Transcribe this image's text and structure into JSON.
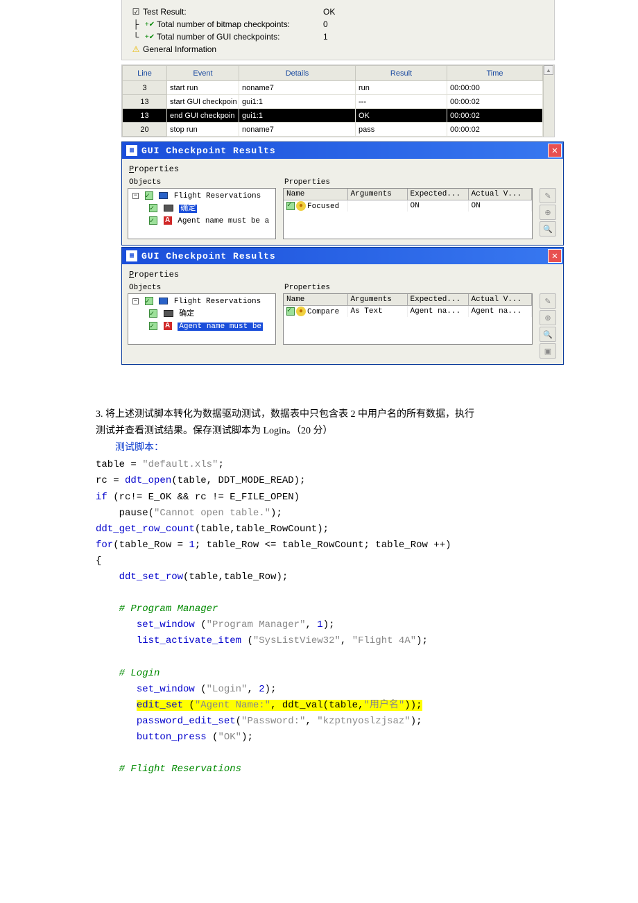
{
  "summary": {
    "rows": [
      {
        "icon": "☑",
        "label": "Test Result:",
        "value": "OK"
      },
      {
        "icon": "+✔",
        "label": "Total number of bitmap checkpoints:",
        "value": "0"
      },
      {
        "icon": "+✔",
        "label": "Total number of GUI checkpoints:",
        "value": "1"
      },
      {
        "icon": "⚠",
        "label": "General Information",
        "value": ""
      }
    ]
  },
  "log": {
    "headers": [
      "Line",
      "Event",
      "Details",
      "Result",
      "Time"
    ],
    "rows": [
      {
        "line": "3",
        "event": "start run",
        "details": "noname7",
        "result": "run",
        "time": "00:00:00",
        "sel": false
      },
      {
        "line": "13",
        "event": "start GUI checkpoin",
        "details": "gui1:1",
        "result": "---",
        "time": "00:00:02",
        "sel": false
      },
      {
        "line": "13",
        "event": "end GUI checkpoin",
        "details": "gui1:1",
        "result": "OK",
        "time": "00:00:02",
        "sel": true
      },
      {
        "line": "20",
        "event": "stop run",
        "details": "noname7",
        "result": "pass",
        "time": "00:00:02",
        "sel": false
      }
    ]
  },
  "gcr1": {
    "title": "GUI Checkpoint Results",
    "section": "Properties",
    "objects_label": "Objects",
    "properties_label": "Properties",
    "tree": {
      "root": "Flight Reservations",
      "child1": "确定",
      "child1_sel": true,
      "child2": "Agent name must be a"
    },
    "prop_headers": [
      "Name",
      "Arguments",
      "Expected...",
      "Actual V..."
    ],
    "prop_row": {
      "name": "Focused",
      "args": "",
      "expected": "ON",
      "actual": "ON"
    }
  },
  "gcr2": {
    "title": "GUI Checkpoint Results",
    "section": "Properties",
    "objects_label": "Objects",
    "properties_label": "Properties",
    "tree": {
      "root": "Flight Reservations",
      "child1": "确定",
      "child1_sel": false,
      "child2": "Agent name must be",
      "child2_sel": true
    },
    "prop_headers": [
      "Name",
      "Arguments",
      "Expected...",
      "Actual V..."
    ],
    "prop_row": {
      "name": "Compare",
      "args": "As Text",
      "expected": "Agent na...",
      "actual": "Agent na..."
    }
  },
  "doc": {
    "q3a": "3. 将上述测试脚本转化为数据驱动测试，数据表中只包含表 2 中用户名的所有数据，执行",
    "q3b": "测试并查看测试结果。保存测试脚本为 Login。（20 分）",
    "label_script": "测试脚本："
  },
  "script": {
    "l1_a": "table = ",
    "l1_s": "\"default.xls\"",
    "l1_c": ";",
    "l2_a": "rc = ",
    "l2_f": "ddt_open",
    "l2_b": "(table, DDT_MODE_READ);",
    "l3_a": "if",
    "l3_b": " (rc!= E_OK && rc != E_FILE_OPEN)",
    "l4_a": "    pause(",
    "l4_s": "\"Cannot open table.\"",
    "l4_b": ");",
    "l5_f": "ddt_get_row_count",
    "l5_b": "(table,table_RowCount);",
    "l6_a": "for",
    "l6_b": "(table_Row = ",
    "l6_n": "1",
    "l6_c": "; table_Row <= table_RowCount; table_Row ++)",
    "l7": "{",
    "l8_a": "    ",
    "l8_f": "ddt_set_row",
    "l8_b": "(table,table_Row);",
    "l10": "    # Program Manager",
    "l11_a": "       ",
    "l11_f": "set_window",
    "l11_b": " (",
    "l11_s": "\"Program Manager\"",
    "l11_c": ", ",
    "l11_n": "1",
    "l11_d": ");",
    "l12_a": "       ",
    "l12_f": "list_activate_item",
    "l12_b": " (",
    "l12_s1": "\"SysListView32\"",
    "l12_c": ", ",
    "l12_s2": "\"Flight 4A\"",
    "l12_d": ");",
    "l14": "    # Login",
    "l15_a": "       ",
    "l15_f": "set_window",
    "l15_b": " (",
    "l15_s": "\"Login\"",
    "l15_c": ", ",
    "l15_n": "2",
    "l15_d": ");",
    "l16_a": "       ",
    "l16_f": "edit_set",
    "l16_b": " (",
    "l16_s": "\"Agent Name:\"",
    "l16_c": ", ddt_val(table,",
    "l16_s2": "\"用户名\"",
    "l16_d": "));",
    "l17_a": "       ",
    "l17_f": "password_edit_set",
    "l17_b": "(",
    "l17_s1": "\"Password:\"",
    "l17_c": ", ",
    "l17_s2": "\"kzptnyoslzjsaz\"",
    "l17_d": ");",
    "l18_a": "       ",
    "l18_f": "button_press",
    "l18_b": " (",
    "l18_s": "\"OK\"",
    "l18_d": ");",
    "l20": "    # Flight Reservations"
  }
}
